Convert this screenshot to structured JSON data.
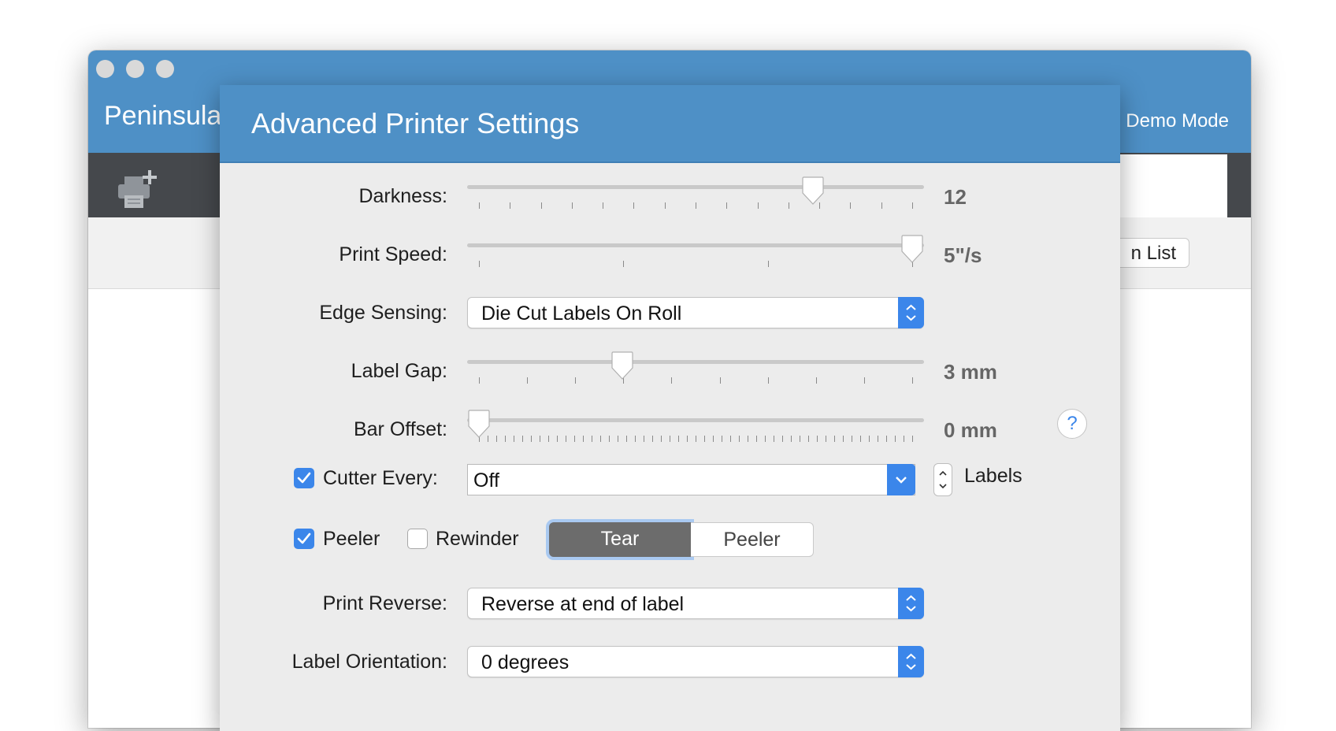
{
  "app": {
    "title": "Peninsula",
    "mode_label": "Demo Mode",
    "list_button_label": "n List",
    "header_color": "#4e90c6"
  },
  "dialog": {
    "title": "Advanced Printer Settings",
    "darkness": {
      "label": "Darkness:",
      "value_text": "12",
      "level_fraction": 0.77
    },
    "print_speed": {
      "label": "Print Speed:",
      "value_text": "5\"/s",
      "level_fraction": 1.0
    },
    "edge_sensing": {
      "label": "Edge Sensing:",
      "selected": "Die Cut Labels On Roll"
    },
    "label_gap": {
      "label": "Label Gap:",
      "value_text": "3 mm",
      "level_fraction": 0.33
    },
    "bar_offset": {
      "label": "Bar Offset:",
      "value_text": "0 mm",
      "level_fraction": 0.0,
      "help_icon": "?"
    },
    "cutter_every": {
      "label": "Cutter Every:",
      "checked": true,
      "value": "Off",
      "unit_label": "Labels"
    },
    "peeler_check": {
      "label": "Peeler",
      "checked": true
    },
    "rewinder_check": {
      "label": "Rewinder",
      "checked": false
    },
    "mode_segments": {
      "options": [
        "Tear",
        "Peeler"
      ],
      "selected": "Tear"
    },
    "print_reverse": {
      "label": "Print Reverse:",
      "selected": "Reverse at end of label"
    },
    "label_orientation": {
      "label": "Label Orientation:",
      "selected": "0 degrees"
    }
  },
  "icons": {
    "window_controls": [
      "close-button",
      "minimize-button",
      "zoom-button"
    ],
    "toolbar": [
      "add-printer-icon"
    ],
    "popup": "up-down-chevron-icon",
    "combo": "chevron-down-icon",
    "checkbox": "checkmark-icon"
  },
  "colors": {
    "accent": "#3b86ea",
    "selected_segment": "#6c6c6c",
    "value_text": "#666666"
  }
}
